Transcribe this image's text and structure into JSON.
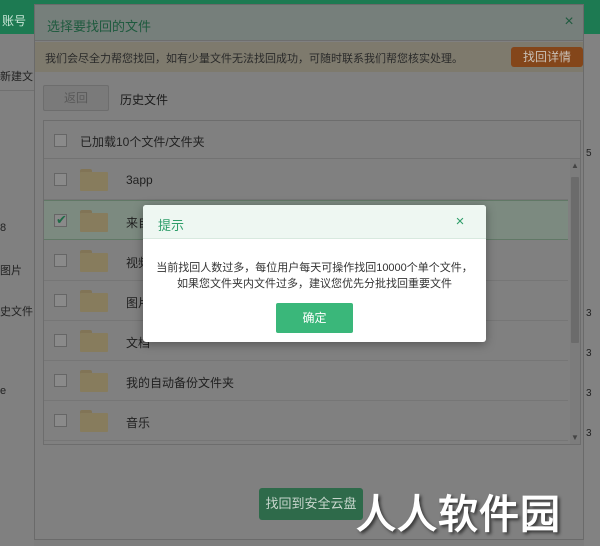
{
  "background": {
    "topbar_text": "账号",
    "left_items": [
      "新建文",
      "8",
      "图片",
      "史文件",
      "e"
    ],
    "right_items": [
      "5",
      "3",
      "3",
      "3",
      "3"
    ]
  },
  "dialog": {
    "title": "选择要找回的文件",
    "notice": "我们会尽全力帮您找回，如有少量文件无法找回成功，可随时联系我们帮您核实处理。",
    "notice_button": "找回详情",
    "back_button": "返回",
    "history_label": "历史文件",
    "list_header": "已加载10个文件/文件夹",
    "rows": [
      {
        "name": "3app",
        "checked": false
      },
      {
        "name": "来自",
        "checked": true
      },
      {
        "name": "视频",
        "checked": false
      },
      {
        "name": "图片",
        "checked": false
      },
      {
        "name": "文档",
        "checked": false
      },
      {
        "name": "我的自动备份文件夹",
        "checked": false
      },
      {
        "name": "音乐",
        "checked": false
      }
    ],
    "recover_button": "找回到安全云盘"
  },
  "modal": {
    "title": "提示",
    "line1": "当前找回人数过多，每位用户每天可操作找回10000个单个文件，",
    "line2": "如果您文件夹内文件过多，建议您优先分批找回重要文件",
    "ok_button": "确定"
  },
  "watermark": "人人软件园",
  "colors": {
    "accent_green": "#3ab77a",
    "notice_orange": "#e0701f",
    "title_green": "#2f9e6a"
  },
  "icons": {
    "close": "×",
    "check": "✔",
    "scroll_up": "▲",
    "scroll_down": "▼"
  }
}
